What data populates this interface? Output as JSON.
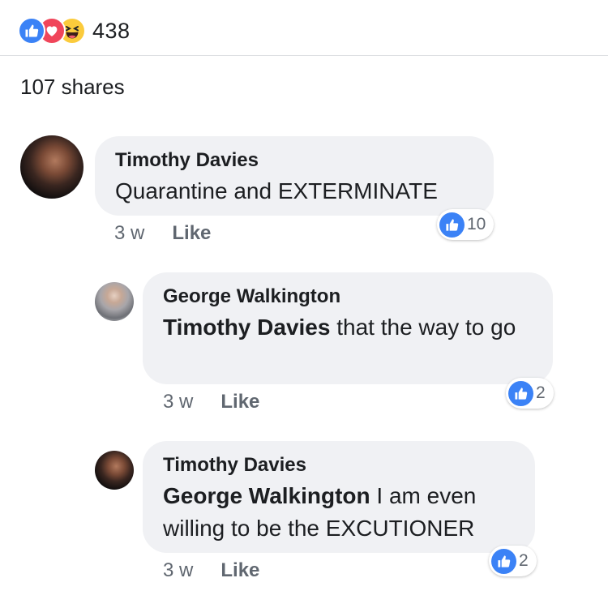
{
  "reactions": {
    "types": [
      "like-icon",
      "love-icon",
      "haha-icon"
    ],
    "count": "438",
    "colors": {
      "like": "#3b82f6",
      "love": "#f0455a",
      "haha": "#fbcb3c"
    }
  },
  "shares_text": "107 shares",
  "comments": [
    {
      "author": "Timothy Davies",
      "mention": "",
      "text": "Quarantine and EXTERMINATE",
      "time": "3 w",
      "like_label": "Like",
      "like_count": "10"
    },
    {
      "author": "George Walkington",
      "mention": "Timothy Davies",
      "text": " that the way to go",
      "time": "3 w",
      "like_label": "Like",
      "like_count": "2"
    },
    {
      "author": "Timothy Davies",
      "mention": "George Walkington",
      "text": " I am even willing to be the EXCUTIONER",
      "time": "3 w",
      "like_label": "Like",
      "like_count": "2"
    }
  ]
}
